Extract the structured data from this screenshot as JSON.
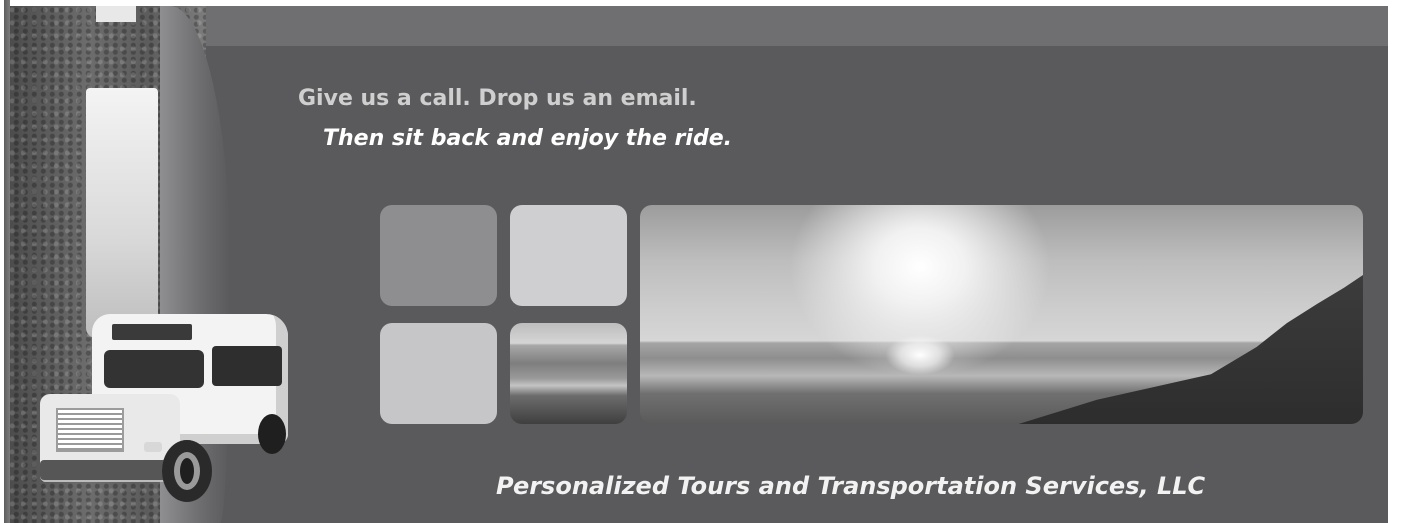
{
  "banner": {
    "tagline_line1": "Give us a call. Drop us an email.",
    "tagline_line2": "Then sit back and enjoy the ride.",
    "company_name": "Personalized Tours and Transportation Services, LLC"
  },
  "colors": {
    "banner_background": "#5a5a5c",
    "top_bar": "#6f6f72",
    "tagline_line1_text": "#cfcfcf",
    "tagline_line2_text": "#ffffff"
  },
  "images": {
    "road": "road-image",
    "bus": "shuttle-bus-image",
    "beach_photo": "beach-sunset-photo"
  }
}
